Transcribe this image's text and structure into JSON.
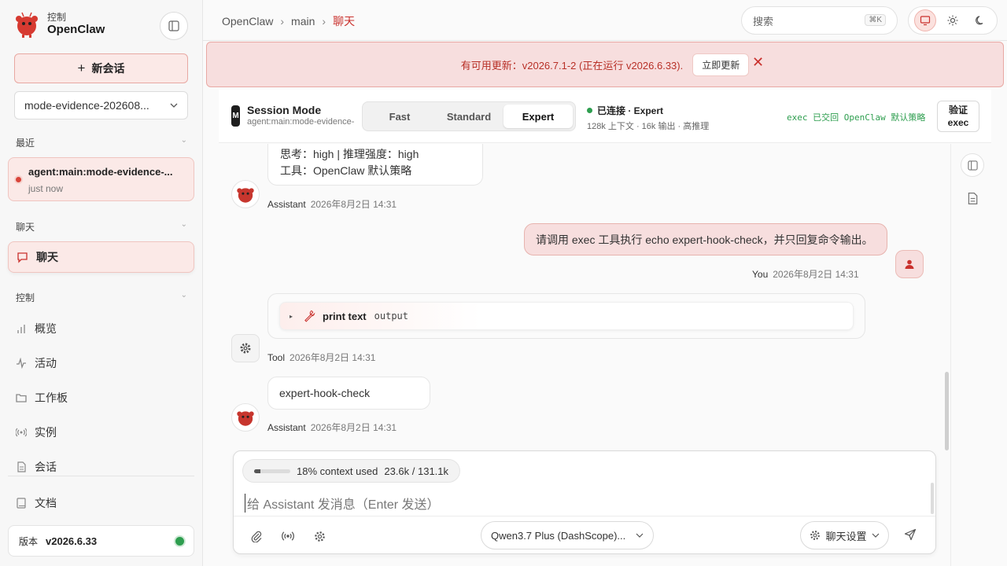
{
  "sidebar": {
    "brand_sub": "控制",
    "brand_title": "OpenClaw",
    "new_chat_label": "新会话",
    "session_select": "mode-evidence-202608...",
    "recent_header": "最近",
    "recent_item": {
      "title": "agent:main:mode-evidence-...",
      "time": "just now"
    },
    "chat_header": "聊天",
    "chat_item": "聊天",
    "control_header": "控制",
    "nav": [
      {
        "label": "概览",
        "icon": "bar-chart-icon"
      },
      {
        "label": "活动",
        "icon": "activity-icon"
      },
      {
        "label": "工作板",
        "icon": "folder-icon"
      },
      {
        "label": "实例",
        "icon": "broadcast-icon"
      },
      {
        "label": "会话",
        "icon": "document-icon"
      }
    ],
    "docs_label": "文档",
    "version_label": "版本",
    "version_value": "v2026.6.33"
  },
  "topbar": {
    "breadcrumb": [
      "OpenClaw",
      "main",
      "聊天"
    ],
    "search_placeholder": "搜索",
    "search_shortcut": "⌘K"
  },
  "banner": {
    "text": "有可用更新：v2026.7.1-2 (正在运行 v2026.6.33).",
    "button": "立即更新"
  },
  "modebar": {
    "icon_letter": "M",
    "title": "Session Mode",
    "subtitle": "agent:main:mode-evidence-",
    "modes": [
      "Fast",
      "Standard",
      "Expert"
    ],
    "active_mode": "Expert",
    "status": "已连接 · Expert",
    "meta": "128k 上下文 · 16k 输出 · 高推理",
    "exec_note": "exec 已交回 OpenClaw 默认策略",
    "verify_line1": "验证",
    "verify_line2": "exec"
  },
  "messages": {
    "first_line1": "思考：high | 推理强度：high",
    "first_line2": "工具：OpenClaw 默认策略",
    "assistant_name": "Assistant",
    "assistant_time_1": "2026年8月2日 14:31",
    "user_text": "请调用 exec 工具执行 echo expert-hook-check，并只回复命令输出。",
    "user_name": "You",
    "user_time": "2026年8月2日 14:31",
    "tool_name": "print text",
    "tool_output": "output",
    "tool_sender": "Tool",
    "tool_time": "2026年8月2日 14:31",
    "reply_text": "expert-hook-check",
    "assistant_time_2": "2026年8月2日 14:31"
  },
  "composer": {
    "context_percent": 18,
    "context_text": "18% context used",
    "context_tokens": "23.6k / 131.1k",
    "placeholder": "给 Assistant 发消息（Enter 发送）",
    "model": "Qwen3.7 Plus (DashScope)...",
    "settings_label": "聊天设置"
  },
  "colors": {
    "accent": "#c9302c",
    "accent_soft": "#fbe9e7",
    "status_green": "#2e9e4f"
  }
}
